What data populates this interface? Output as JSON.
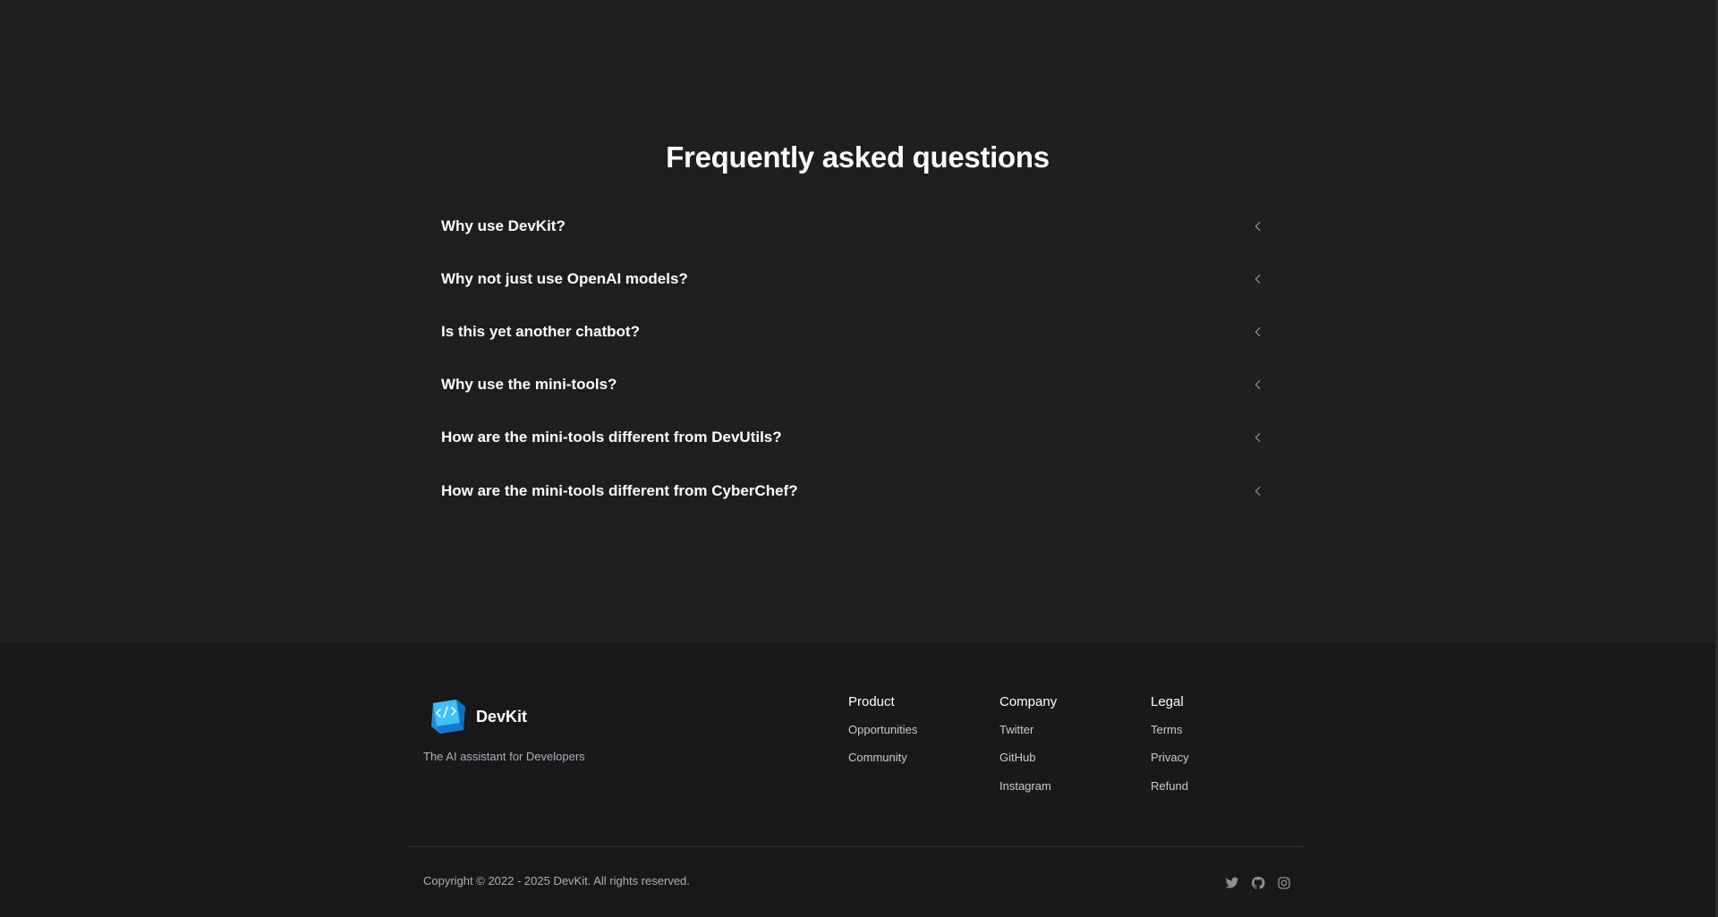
{
  "faq": {
    "title": "Frequently asked questions",
    "items": [
      {
        "question": "Why use DevKit?"
      },
      {
        "question": "Why not just use OpenAI models?"
      },
      {
        "question": "Is this yet another chatbot?"
      },
      {
        "question": "Why use the mini-tools?"
      },
      {
        "question": "How are the mini-tools different from DevUtils?"
      },
      {
        "question": "How are the mini-tools different from CyberChef?"
      }
    ],
    "chevron_icon": "chevron-left-icon"
  },
  "footer": {
    "brand": {
      "name": "DevKit",
      "logo_icon": "devkit-code-cube-icon",
      "tagline": "The AI assistant for Developers"
    },
    "columns": {
      "product": {
        "title": "Product",
        "links": [
          "Opportunities",
          "Community"
        ]
      },
      "company": {
        "title": "Company",
        "links": [
          "Twitter",
          "GitHub",
          "Instagram"
        ]
      },
      "legal": {
        "title": "Legal",
        "links": [
          "Terms",
          "Privacy",
          "Refund"
        ]
      }
    },
    "copyright": "Copyright © 2022 - 2025 DevKit. All rights reserved.",
    "socials": [
      "twitter-icon",
      "github-icon",
      "instagram-icon"
    ]
  },
  "colors": {
    "background": "#1e1e1e",
    "footer_background": "#181818",
    "text_primary": "#ffffff",
    "text_muted": "#a8b0bd",
    "social_icon": "#8a8f99",
    "logo_blue": "#2aa8f0"
  }
}
